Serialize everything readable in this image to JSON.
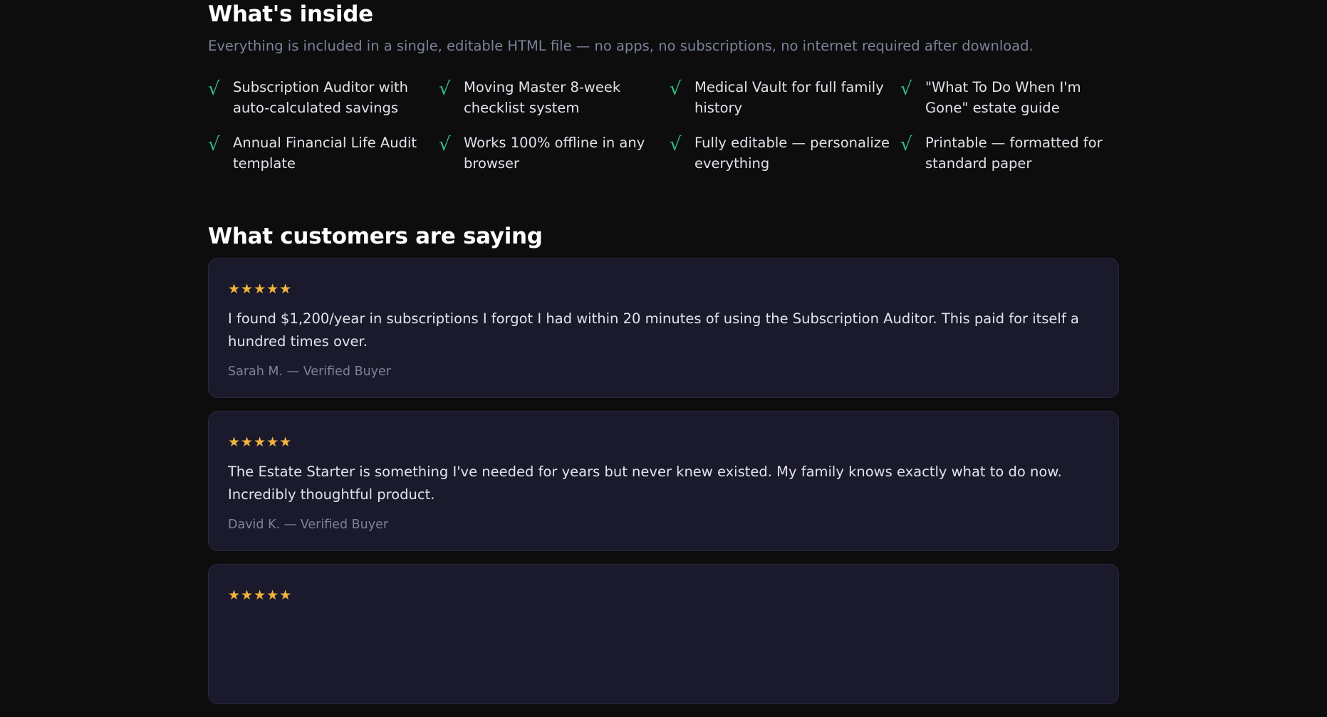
{
  "inside": {
    "title": "What's inside",
    "subtitle": "Everything is included in a single, editable HTML file — no apps, no subscriptions, no internet required after download.",
    "check_glyph": "√",
    "features": [
      "Subscription Auditor with auto-calculated savings",
      "Moving Master 8-week checklist system",
      "Medical Vault for full family history",
      "\"What To Do When I'm Gone\" estate guide",
      "Annual Financial Life Audit template",
      "Works 100% offline in any browser",
      "Fully editable — personalize everything",
      "Printable — formatted for standard paper"
    ]
  },
  "reviews": {
    "title": "What customers are saying",
    "items": [
      {
        "stars": "★★★★★",
        "rating": 5,
        "quote": "I found $1,200/year in subscriptions I forgot I had within 20 minutes of using the Subscription Auditor. This paid for itself a hundred times over.",
        "author": "Sarah M. — Verified Buyer"
      },
      {
        "stars": "★★★★★",
        "rating": 5,
        "quote": "The Estate Starter is something I've needed for years but never knew existed. My family knows exactly what to do now. Incredibly thoughtful product.",
        "author": "David K. — Verified Buyer"
      },
      {
        "stars": "★★★★★",
        "rating": 5,
        "quote": "",
        "author": ""
      }
    ]
  },
  "colors": {
    "background": "#0d0d0e",
    "card": "#1a1a2c",
    "check": "#2fbf7f",
    "stars": "#f2b33d",
    "muted": "#7b8398"
  }
}
